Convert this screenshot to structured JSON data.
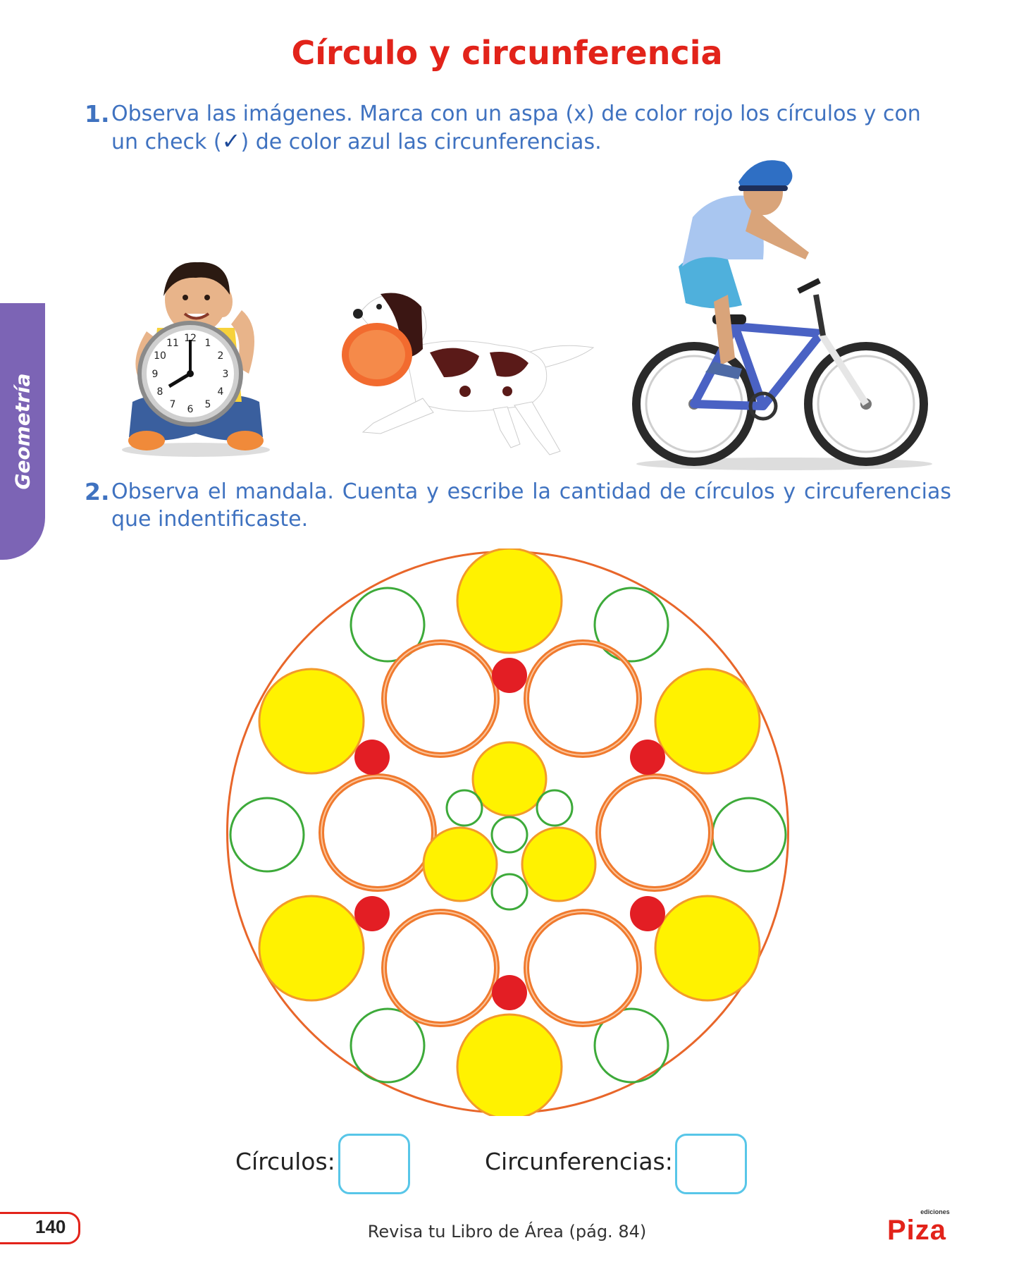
{
  "page": {
    "title": "Círculo y circunferencia",
    "side_tab": "Geometría"
  },
  "questions": [
    {
      "number": "1.",
      "text_before_check": "Observa las imágenes. Marca con un aspa (x) de color rojo los círculos y con un check (",
      "check_symbol": "✓",
      "text_after_check": ") de color azul las circunferencias."
    },
    {
      "number": "2.",
      "text": "Observa el mandala. Cuenta y escribe la cantidad de círculos y circuferencias que indentificaste."
    }
  ],
  "images": [
    {
      "name": "boy-with-clock",
      "clock_numbers": [
        "12",
        "1",
        "2",
        "3",
        "4",
        "5",
        "6",
        "7",
        "8",
        "9",
        "10",
        "11"
      ]
    },
    {
      "name": "dog-with-frisbee"
    },
    {
      "name": "boy-on-bicycle"
    }
  ],
  "colors": {
    "title_red": "#e2231a",
    "instruction_blue": "#3f72c0",
    "side_tab_purple": "#7c64b5",
    "mandala_outline": "#e8662a",
    "ring_orange": "#f07a2e",
    "circle_yellow": "#fff200",
    "circle_yellow_stroke": "#f39a2a",
    "dot_red": "#e31e24",
    "ring_green": "#3daa3a",
    "answer_box": "#58c6e8"
  },
  "answers": {
    "circles_label": "Círculos:",
    "circumferences_label": "Circunferencias:"
  },
  "footer": {
    "page_number": "140",
    "note": "Revisa tu Libro de Área (pág. 84)",
    "logo_small": "ediciones",
    "logo_brand": "Piza"
  }
}
